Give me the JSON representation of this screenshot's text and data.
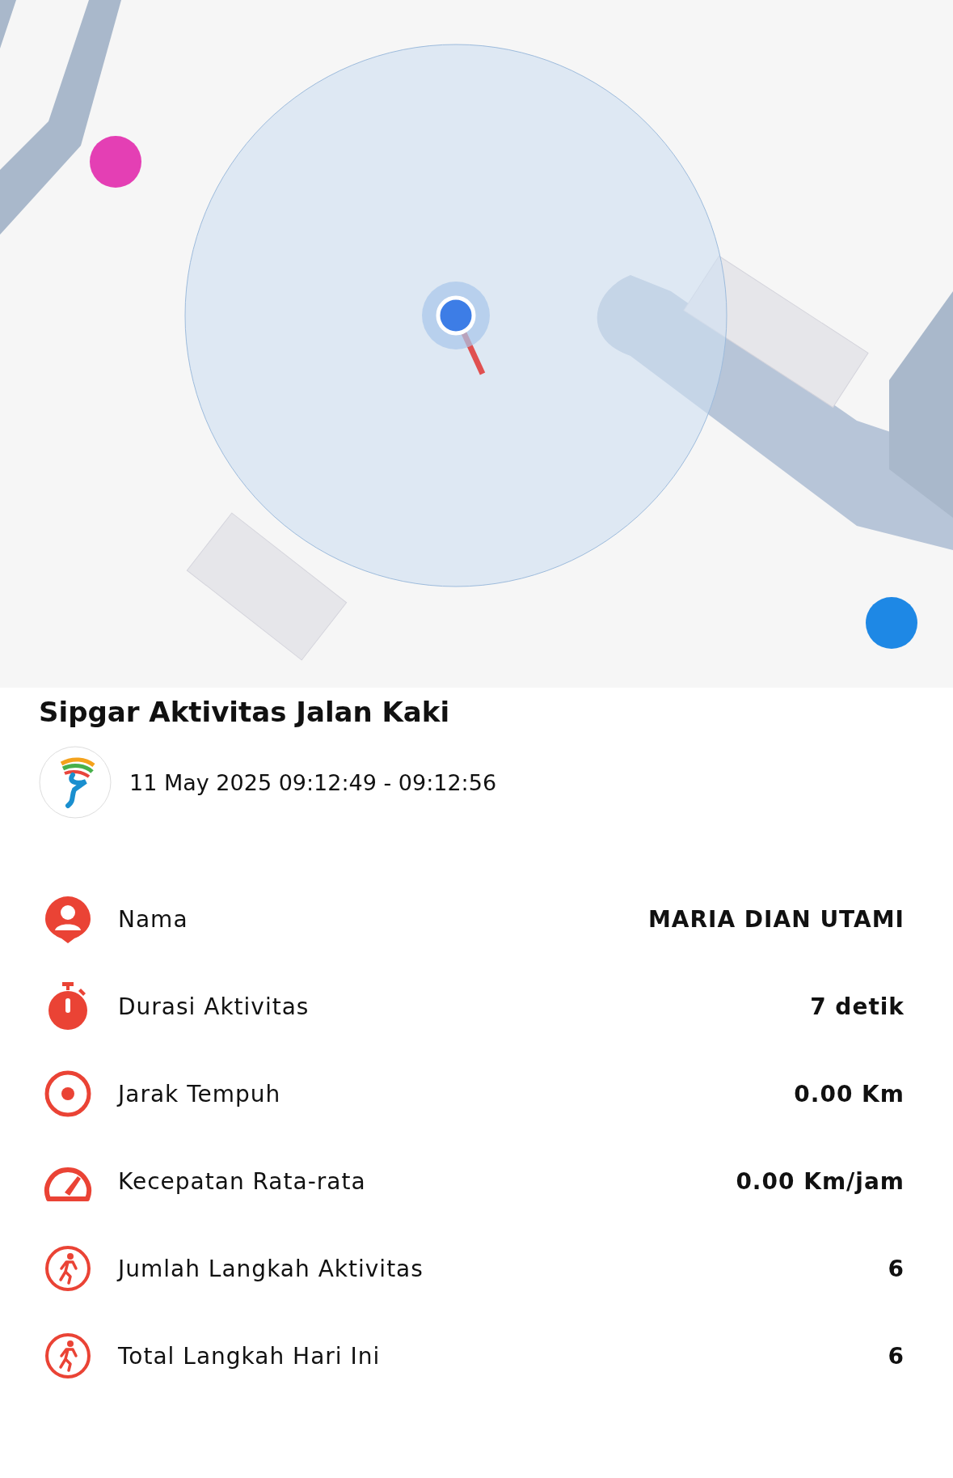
{
  "title": "Sipgar Aktivitas Jalan Kaki",
  "date_range": "11 May 2025 09:12:49 - 09:12:56",
  "stats": [
    {
      "kind": "person",
      "label": "Nama",
      "value": "MARIA DIAN UTAMI"
    },
    {
      "kind": "timer",
      "label": "Durasi Aktivitas",
      "value": "7 detik"
    },
    {
      "kind": "target",
      "label": "Jarak Tempuh",
      "value": "0.00 Km"
    },
    {
      "kind": "speed",
      "label": "Kecepatan Rata-rata",
      "value": "0.00 Km/jam"
    },
    {
      "kind": "steps",
      "label": "Jumlah Langkah Aktivitas",
      "value": "6"
    },
    {
      "kind": "steps",
      "label": "Total Langkah Hari Ini",
      "value": "6"
    }
  ]
}
